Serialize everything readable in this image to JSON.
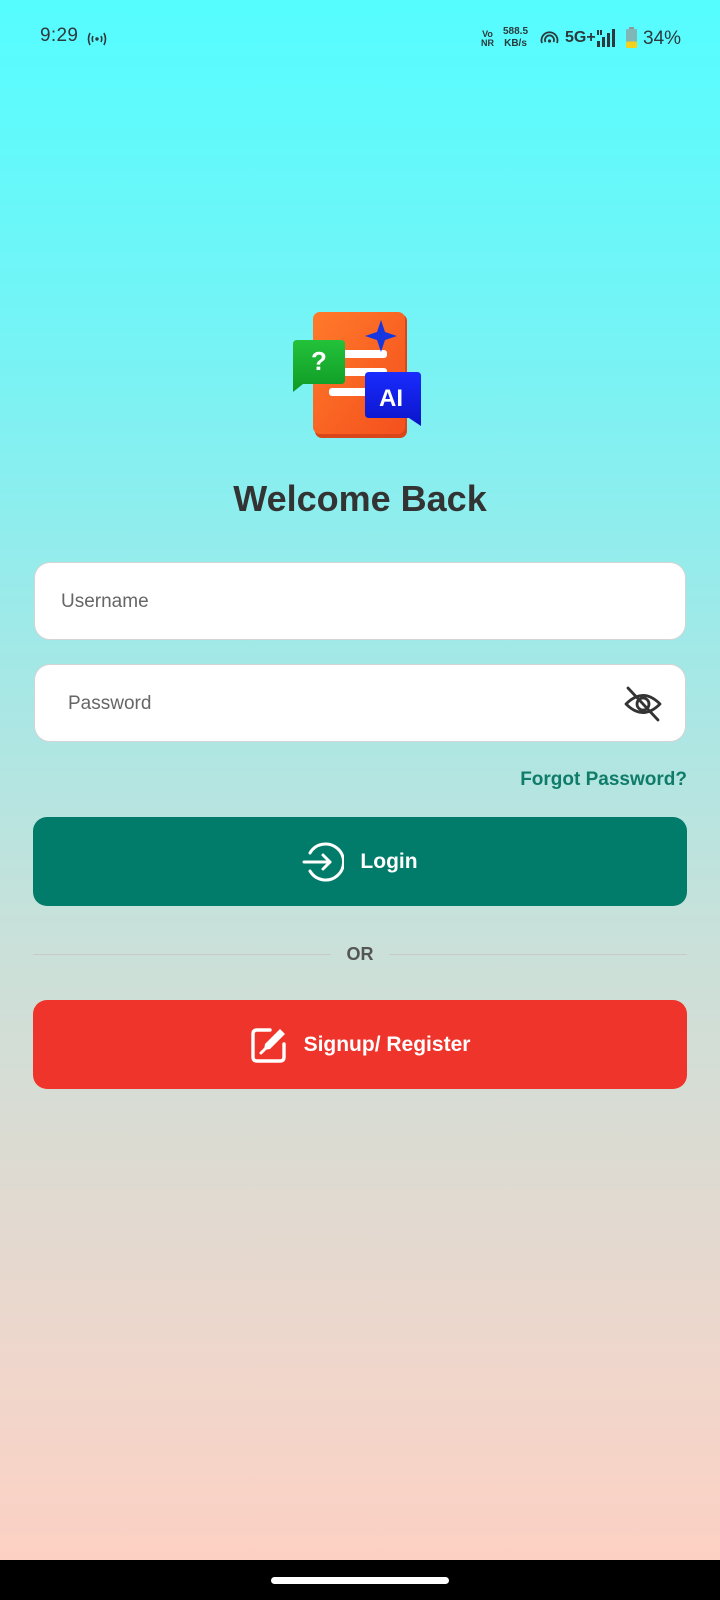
{
  "status_bar": {
    "time": "9:29",
    "volte_line1": "Vo",
    "volte_line2": "NR",
    "net_speed_value": "588.5",
    "net_speed_unit": "KB/s",
    "network_type": "5G+",
    "battery_percent": "34%",
    "battery_level": 0.34
  },
  "logo": {
    "icon": "ai-chat-document-logo",
    "question_mark": "?",
    "badge_text": "AI"
  },
  "login": {
    "title": "Welcome Back",
    "username_placeholder": "Username",
    "username_value": "",
    "password_placeholder": "Password",
    "password_value": "",
    "password_visibility_icon": "eye-off-icon",
    "forgot_password_label": "Forgot Password?",
    "login_button_label": "Login",
    "login_icon": "login-arrow-icon",
    "divider_label": "OR",
    "signup_button_label": "Signup/ Register",
    "signup_icon": "edit-square-icon"
  },
  "colors": {
    "primary_green": "#027c6a",
    "signup_red": "#ef342c",
    "link_green": "#0f7c69",
    "gradient_top": "#55fdff",
    "gradient_bottom": "#ffd0c2"
  }
}
